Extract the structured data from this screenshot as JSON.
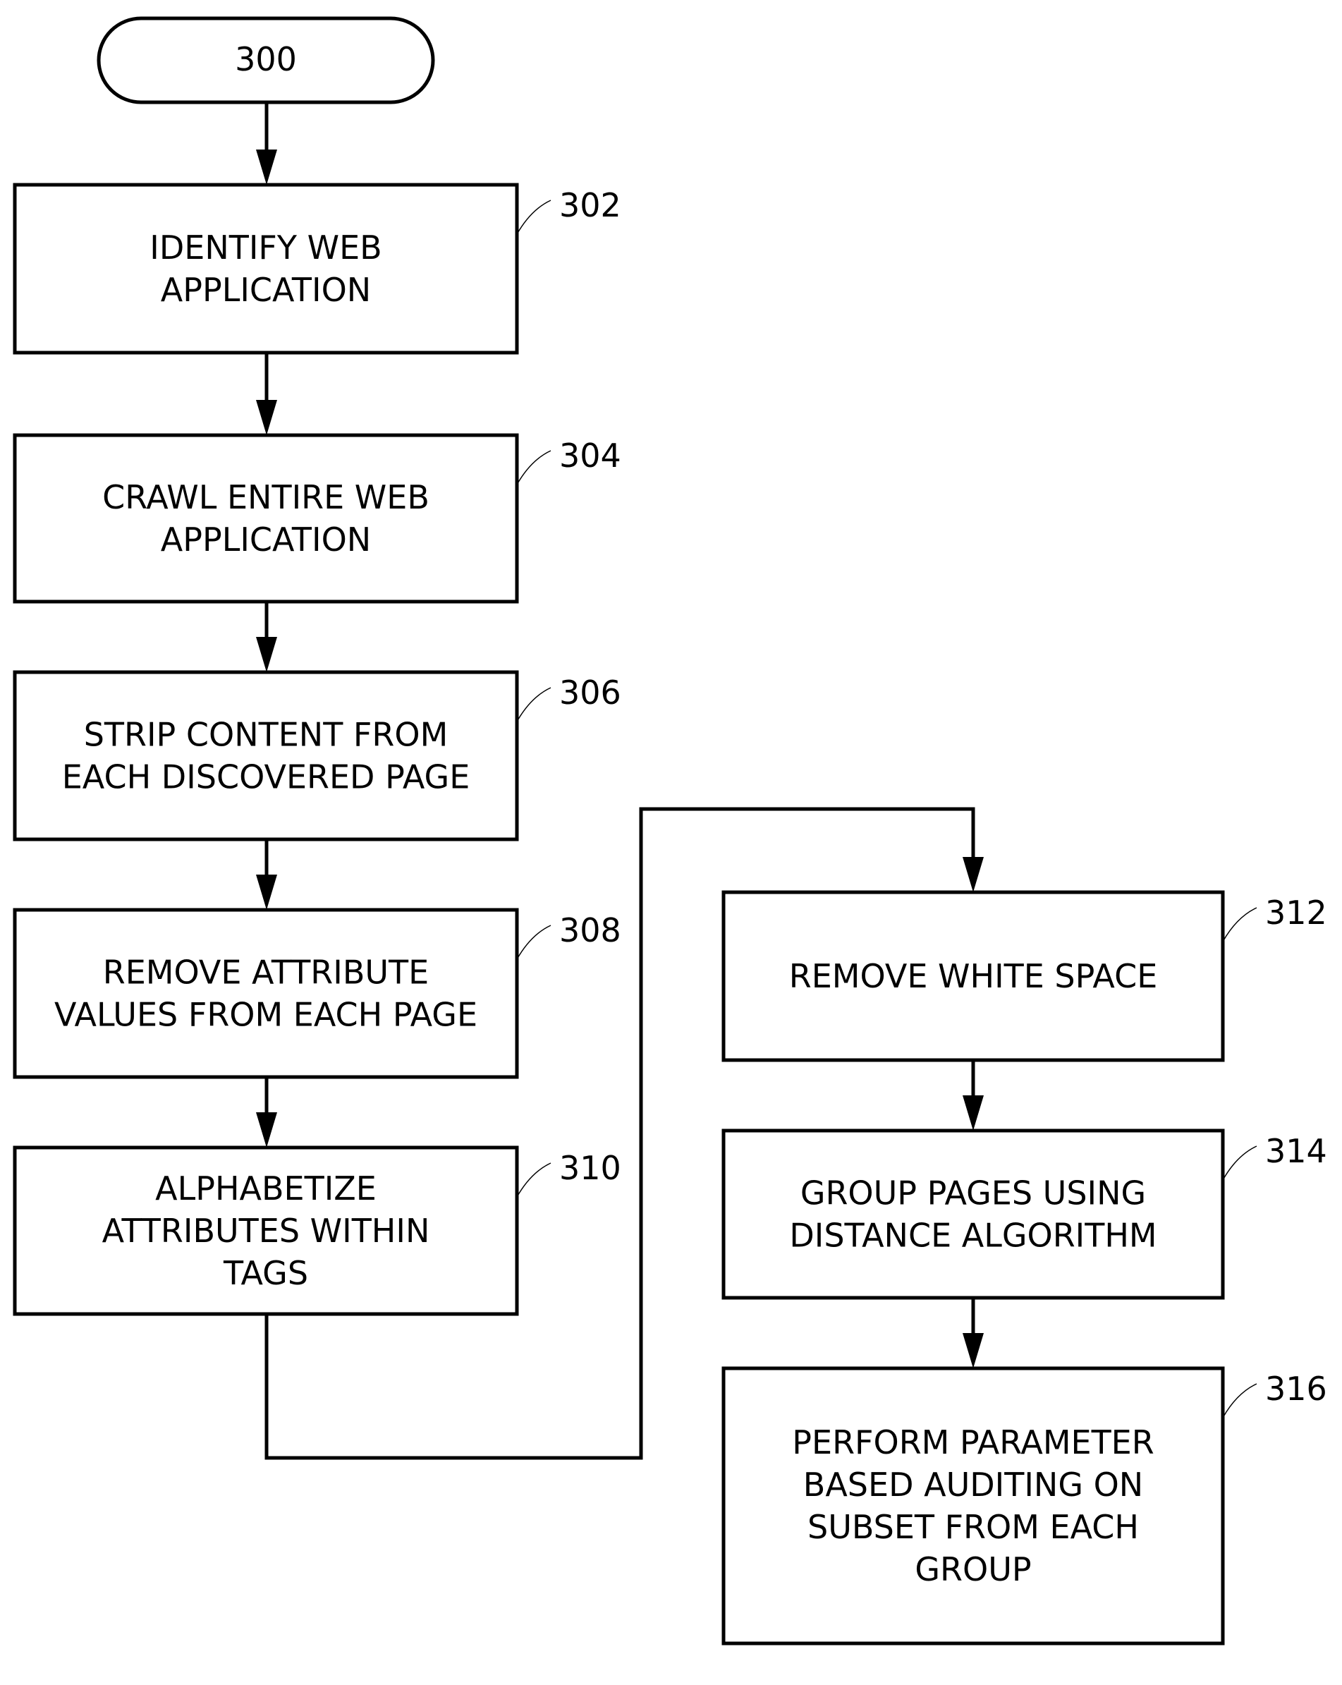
{
  "figure": {
    "start": {
      "ref": "300"
    },
    "steps": [
      {
        "ref": "302",
        "lines": [
          "IDENTIFY WEB",
          "APPLICATION"
        ]
      },
      {
        "ref": "304",
        "lines": [
          "CRAWL ENTIRE WEB",
          "APPLICATION"
        ]
      },
      {
        "ref": "306",
        "lines": [
          "STRIP CONTENT FROM",
          "EACH DISCOVERED PAGE"
        ]
      },
      {
        "ref": "308",
        "lines": [
          "REMOVE ATTRIBUTE",
          "VALUES FROM EACH PAGE"
        ]
      },
      {
        "ref": "310",
        "lines": [
          "ALPHABETIZE",
          "ATTRIBUTES WITHIN",
          "TAGS"
        ]
      },
      {
        "ref": "312",
        "lines": [
          "REMOVE WHITE SPACE"
        ]
      },
      {
        "ref": "314",
        "lines": [
          "GROUP PAGES USING",
          "DISTANCE ALGORITHM"
        ]
      },
      {
        "ref": "316",
        "lines": [
          "PERFORM PARAMETER",
          "BASED AUDITING ON",
          "SUBSET FROM EACH",
          "GROUP"
        ]
      }
    ],
    "flow": [
      "300",
      "302",
      "304",
      "306",
      "308",
      "310",
      "312",
      "314",
      "316"
    ]
  }
}
